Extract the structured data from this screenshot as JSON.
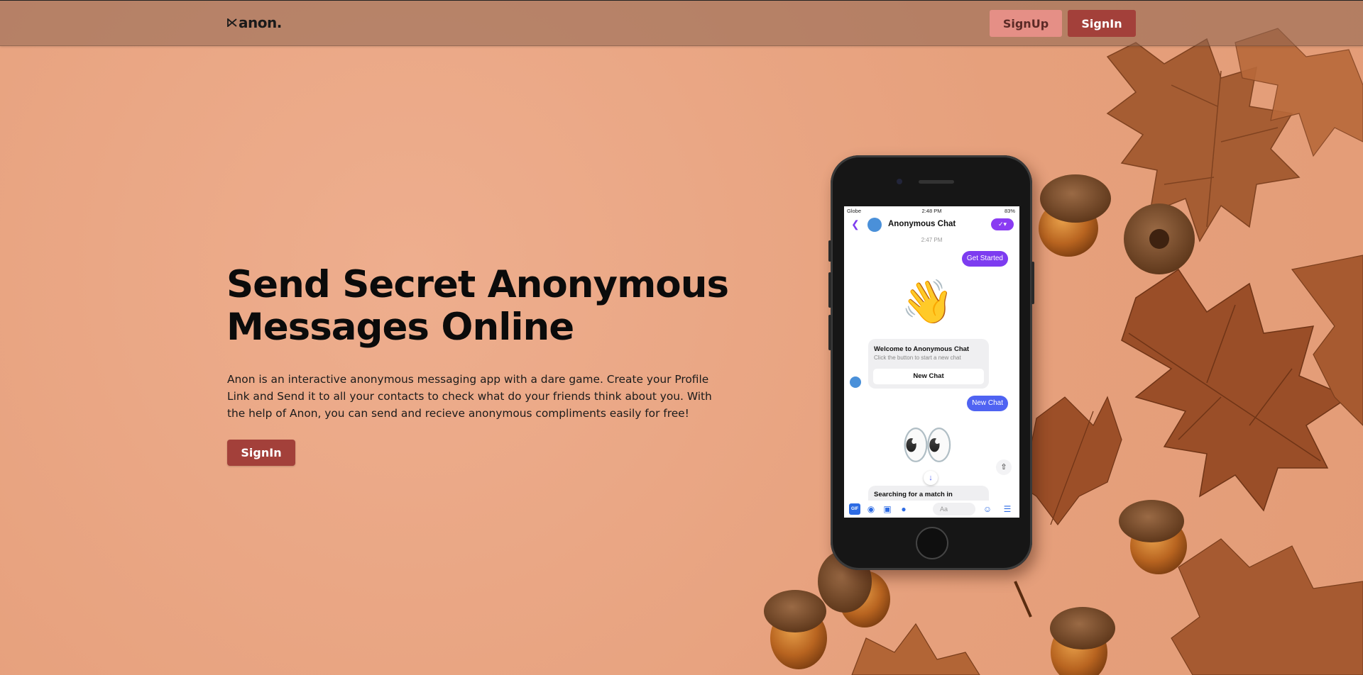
{
  "nav": {
    "logo_text": "anon.",
    "signup_label": "SignUp",
    "signin_label": "SignIn"
  },
  "hero": {
    "title": "Send Secret Anonymous Messages Online",
    "description": "Anon is an interactive anonymous messaging app with a dare game. Create your Profile Link and Send it to all your contacts to check what do your friends think about you. With the help of Anon, you can send and recieve anonymous compliments easily for free!",
    "signin_label": "SignIn"
  },
  "phone": {
    "status": {
      "carrier": "Globe",
      "time": "2:48 PM",
      "battery": "83%"
    },
    "chat_title": "Anonymous Chat",
    "timestamp": "2:47 PM",
    "messages": {
      "get_started": "Get Started",
      "new_chat_out": "New Chat"
    },
    "emojis": {
      "wave": "👋",
      "eyes": "👀"
    },
    "welcome_card": {
      "title": "Welcome to Anonymous Chat",
      "subtitle": "Click the button to start a new chat",
      "button": "New Chat"
    },
    "searching_card": {
      "title": "Searching for a match in"
    },
    "composer": {
      "placeholder": "Aa",
      "gif_label": "GIF"
    }
  },
  "colors": {
    "background": "#e9a582",
    "navbar": "#8c6450",
    "signup_bg": "#e58f86",
    "signin_bg": "#a3403a",
    "chat_accent": "#7d3cf0",
    "chat_blue": "#4f63f2"
  }
}
